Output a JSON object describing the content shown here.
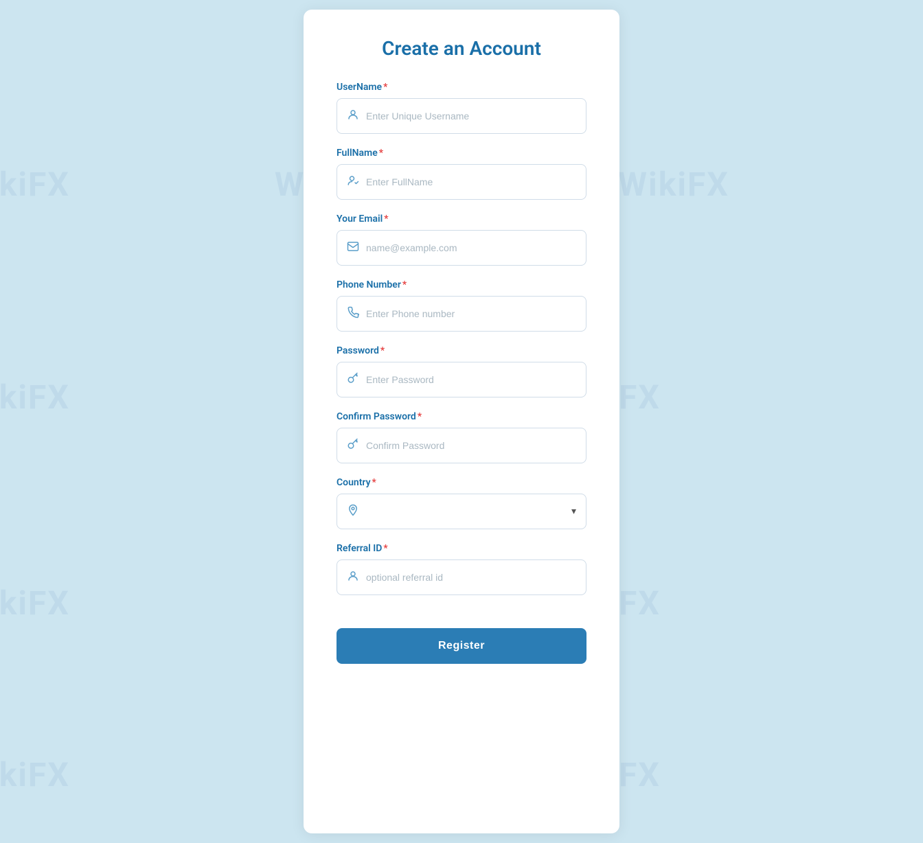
{
  "page": {
    "background_color": "#cce5f0"
  },
  "watermarks": [
    "WikiFX",
    "WikiFX",
    "WikiFX",
    "WikiFX",
    "WikiFX",
    "WikiFX",
    "WikiFX",
    "WikiFX",
    "WikiFX"
  ],
  "form": {
    "title": "Create an Account",
    "fields": {
      "username": {
        "label": "UserName",
        "required": true,
        "placeholder": "Enter Unique Username",
        "type": "text",
        "icon": "person"
      },
      "fullname": {
        "label": "FullName",
        "required": true,
        "placeholder": "Enter FullName",
        "type": "text",
        "icon": "person-edit"
      },
      "email": {
        "label": "Your Email",
        "required": true,
        "placeholder": "name@example.com",
        "type": "email",
        "icon": "mail"
      },
      "phone": {
        "label": "Phone Number",
        "required": true,
        "placeholder": "Enter Phone number",
        "type": "tel",
        "icon": "phone"
      },
      "password": {
        "label": "Password",
        "required": true,
        "placeholder": "Enter Password",
        "type": "password",
        "icon": "key"
      },
      "confirm_password": {
        "label": "Confirm Password",
        "required": true,
        "placeholder": "Confirm Password",
        "type": "password",
        "icon": "key"
      },
      "country": {
        "label": "Country",
        "required": true,
        "placeholder": "",
        "type": "select",
        "icon": "location"
      },
      "referral": {
        "label": "Referral ID",
        "required": true,
        "placeholder": "optional referral id",
        "type": "text",
        "icon": "person"
      }
    },
    "submit_label": "Register",
    "required_marker": "*"
  }
}
